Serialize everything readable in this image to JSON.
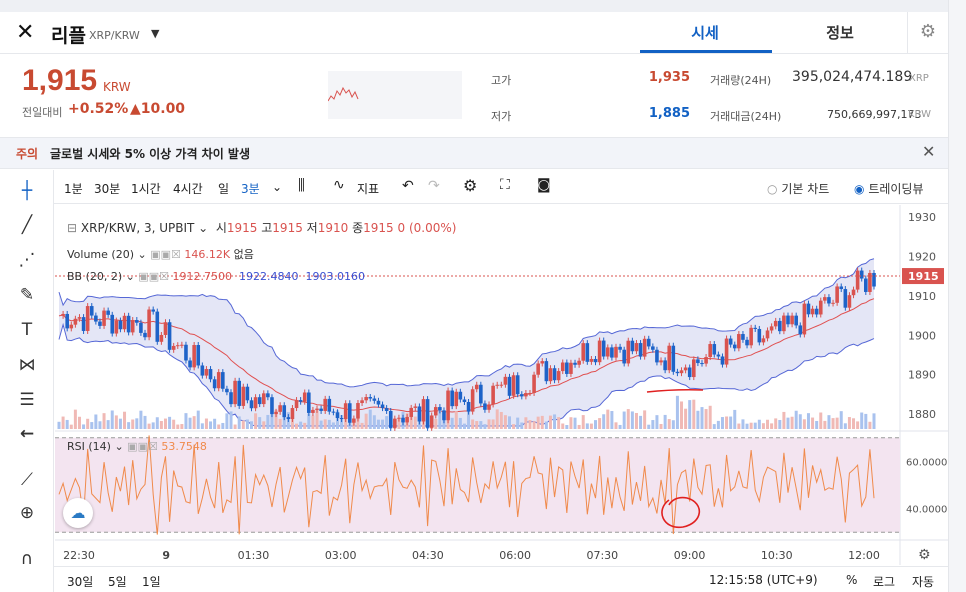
{
  "coin": {
    "name": "리플",
    "pair": "XRP/KRW",
    "logo_icon": "xrp-logo-icon"
  },
  "tabs": {
    "price": "시세",
    "info": "정보"
  },
  "price": {
    "current": "1,915",
    "unit": "KRW",
    "change_label": "전일대비",
    "change_rate": "+0.52%",
    "change_abs": "▲10.00",
    "color_up": "#c84a31"
  },
  "stats": {
    "high_label": "고가",
    "high_value": "1,935",
    "low_label": "저가",
    "low_value": "1,885",
    "volume_label": "거래량(24H)",
    "volume_value": "395,024,474.189",
    "volume_unit": "XRP",
    "amount_label": "거래대금(24H)",
    "amount_value": "750,669,997,173",
    "amount_unit": "KRW"
  },
  "notice": {
    "tag": "주의",
    "text": "글로벌 시세와 5% 이상 가격 차이 발생"
  },
  "toolbar": {
    "intervals": [
      "1분",
      "30분",
      "1시간",
      "4시간",
      "일",
      "3분"
    ],
    "active_interval": "3분",
    "indicator_label": "지표",
    "basic_chart": "기본 차트",
    "tradingview": "트레이딩뷰"
  },
  "legend": {
    "symbol": "XRP/KRW, 3, UPBIT",
    "o_label": "시",
    "o": "1915",
    "h_label": "고",
    "h": "1915",
    "l_label": "저",
    "l": "1910",
    "c_label": "종",
    "c": "1915",
    "chg": "0 (0.00%)",
    "volume_label": "Volume (20)",
    "volume_value": "146.12K",
    "volume_extra": "없음",
    "bb_label": "BB (20, 2)",
    "bb_mid": "1912.7500",
    "bb_up": "1922.4840",
    "bb_low": "1903.0160",
    "rsi_label": "RSI (14)",
    "rsi_value": "53.7548"
  },
  "price_axis": [
    "1930",
    "1920",
    "1910",
    "1900",
    "1890",
    "1880"
  ],
  "price_marker": "1915",
  "rsi_axis": [
    "60.0000",
    "40.0000"
  ],
  "time_axis": [
    "22:30",
    "9",
    "01:30",
    "03:00",
    "04:30",
    "06:00",
    "07:30",
    "09:00",
    "10:30",
    "12:00"
  ],
  "bottom": {
    "ranges": [
      "30일",
      "5일",
      "1일"
    ],
    "clock": "12:15:58 (UTC+9)",
    "percent": "%",
    "log": "로그",
    "auto": "자동"
  },
  "colors": {
    "up": "#d9534f",
    "down": "#1e63c8",
    "band_fill": "#d8dcf2",
    "band_line": "#5567d6",
    "rsi_fill": "#f3e4f0",
    "rsi_line": "#f08a4b",
    "accent": "#1261c4"
  },
  "chart_data": {
    "type": "candlestick",
    "x": [
      "22:30",
      "9",
      "01:30",
      "03:00",
      "04:30",
      "06:00",
      "07:30",
      "09:00",
      "10:30",
      "12:00"
    ],
    "close_approx": [
      1905,
      1903,
      1884,
      1881,
      1880,
      1887,
      1898,
      1893,
      1901,
      1915
    ],
    "y_range": [
      1876,
      1933
    ],
    "rsi_range": [
      28,
      72
    ]
  }
}
